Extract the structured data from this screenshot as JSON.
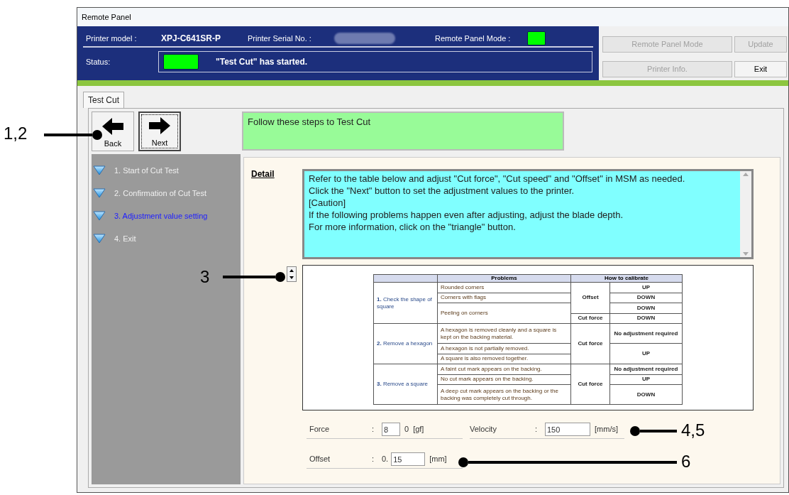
{
  "window": {
    "title": "Remote Panel"
  },
  "header": {
    "model_label": "Printer model :",
    "model": "XPJ-C641SR-P",
    "serial_label": "Printer Serial No. :",
    "mode_label": "Remote Panel Mode :",
    "mode_on": true,
    "status_label": "Status:",
    "status_ok": true,
    "status_message": "\"Test Cut\" has started."
  },
  "buttons": [
    {
      "label": "Remote Panel Mode",
      "disabled": true
    },
    {
      "label": "Update",
      "disabled": true
    },
    {
      "label": "Printer Info.",
      "disabled": true
    },
    {
      "label": "Exit",
      "disabled": false
    }
  ],
  "tabs": [
    {
      "label": "Test Cut",
      "selected": true
    }
  ],
  "nav": [
    {
      "kind": "back",
      "label": "Back",
      "focused": false
    },
    {
      "kind": "next",
      "label": "Next",
      "focused": true
    }
  ],
  "message": "Follow these steps to Test Cut",
  "steps": [
    {
      "label": "1. Start of Cut Test",
      "selected": false
    },
    {
      "label": "2. Confirmation of Cut Test",
      "selected": false
    },
    {
      "label": "3. Adjustment value setting",
      "selected": true
    },
    {
      "label": "4. Exit",
      "selected": false
    }
  ],
  "detail": {
    "label": "Detail",
    "lines": [
      "Refer to the table below and adjust \"Cut force\", \"Cut speed\" and \"Offset\" in MSM as needed.",
      "Click the \"Next\" button to set the adjustment values to the printer.",
      "[Caution]",
      "If the following problems happen even after adjusting, adjust the blade depth.",
      "For more information, click on the \"triangle\" button."
    ]
  },
  "table": {
    "columns": [
      {
        "text": ""
      },
      {
        "text": "Problems"
      },
      {
        "text": "How to calibrate",
        "colspan": 2
      }
    ],
    "rows": [
      [
        {
          "kind": "group",
          "text": "**1.** Check the shape of square",
          "rowspan": 4
        },
        {
          "kind": "problem",
          "text": "Rounded corners"
        },
        {
          "kind": "param",
          "text": "Offset",
          "rowspan": 3
        },
        {
          "kind": "direction",
          "text": "UP"
        }
      ],
      [
        {
          "kind": "problem",
          "text": "Corners with flags"
        },
        {
          "kind": "direction",
          "text": "DOWN"
        }
      ],
      [
        {
          "kind": "problem",
          "text": "Peeling on corners",
          "rowspan": 2
        },
        {
          "kind": "direction",
          "text": "DOWN"
        }
      ],
      [
        {
          "kind": "param",
          "text": "Cut force"
        },
        {
          "kind": "direction",
          "text": "DOWN"
        }
      ],
      [
        {
          "kind": "group",
          "text": "**2.** Remove a hexagon",
          "rowspan": 3
        },
        {
          "kind": "problem",
          "text": "A hexagon is removed cleanly and a square is kept on the backing material."
        },
        {
          "kind": "param",
          "text": "Cut force",
          "rowspan": 3
        },
        {
          "kind": "direction",
          "text": "No adjustment required"
        }
      ],
      [
        {
          "kind": "problem",
          "text": "A hexagon is not partially removed."
        },
        {
          "kind": "direction",
          "text": "UP",
          "rowspan": 2
        }
      ],
      [
        {
          "kind": "problem",
          "text": "A square is also removed together."
        }
      ],
      [
        {
          "kind": "group",
          "text": "**3.** Remove a square",
          "rowspan": 3
        },
        {
          "kind": "problem",
          "text": "A faint cut mark appears on the backing."
        },
        {
          "kind": "param",
          "text": "Cut force",
          "rowspan": 3
        },
        {
          "kind": "direction",
          "text": "No adjustment required"
        }
      ],
      [
        {
          "kind": "problem",
          "text": "No cut mark appears on the backing."
        },
        {
          "kind": "direction",
          "text": "UP"
        }
      ],
      [
        {
          "kind": "problem",
          "text": "A deep cut mark appears on the backing or the backing was completely cut through."
        },
        {
          "kind": "direction",
          "text": "DOWN"
        }
      ]
    ]
  },
  "fields": [
    {
      "label": "Force",
      "separator": ":",
      "value": "8",
      "after": "0",
      "unit": "[gf]"
    },
    {
      "label": "Velocity",
      "separator": ":",
      "value": "150",
      "unit": "[mm/s]"
    },
    {
      "label": "Offset",
      "separator": ":",
      "before": "0.",
      "value": "15",
      "unit": "[mm]"
    }
  ],
  "annotations": [
    {
      "label": "1,2"
    },
    {
      "label": "3"
    },
    {
      "label": "4,5"
    },
    {
      "label": "6"
    }
  ]
}
